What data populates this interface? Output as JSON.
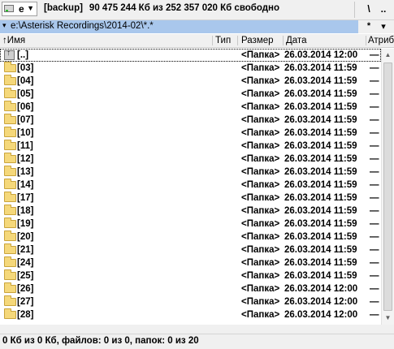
{
  "drive": {
    "letter": "e",
    "label": "[backup]",
    "free_space": "90 475 244 Кб из 252 357 020 Кб свободно",
    "root_button": "\\",
    "parent_button": ".."
  },
  "path": {
    "caret": "▾",
    "text": "e:\\Asterisk Recordings\\2014-02\\*.*",
    "history_button": "*",
    "dropdown_button": "▾"
  },
  "columns": {
    "sort_arrow": "↑",
    "name": "Имя",
    "type": "Тип",
    "size": "Размер",
    "date": "Дата",
    "attr": "Атриб"
  },
  "rows": [
    {
      "name": "[..]",
      "size": "<Папка>",
      "date": "26.03.2014 12:00",
      "attr": "—",
      "icon": "up-dir-icon"
    },
    {
      "name": "[03]",
      "size": "<Папка>",
      "date": "26.03.2014 11:59",
      "attr": "—",
      "icon": "folder-icon"
    },
    {
      "name": "[04]",
      "size": "<Папка>",
      "date": "26.03.2014 11:59",
      "attr": "—",
      "icon": "folder-icon"
    },
    {
      "name": "[05]",
      "size": "<Папка>",
      "date": "26.03.2014 11:59",
      "attr": "—",
      "icon": "folder-icon"
    },
    {
      "name": "[06]",
      "size": "<Папка>",
      "date": "26.03.2014 11:59",
      "attr": "—",
      "icon": "folder-icon"
    },
    {
      "name": "[07]",
      "size": "<Папка>",
      "date": "26.03.2014 11:59",
      "attr": "—",
      "icon": "folder-icon"
    },
    {
      "name": "[10]",
      "size": "<Папка>",
      "date": "26.03.2014 11:59",
      "attr": "—",
      "icon": "folder-icon"
    },
    {
      "name": "[11]",
      "size": "<Папка>",
      "date": "26.03.2014 11:59",
      "attr": "—",
      "icon": "folder-icon"
    },
    {
      "name": "[12]",
      "size": "<Папка>",
      "date": "26.03.2014 11:59",
      "attr": "—",
      "icon": "folder-icon"
    },
    {
      "name": "[13]",
      "size": "<Папка>",
      "date": "26.03.2014 11:59",
      "attr": "—",
      "icon": "folder-icon"
    },
    {
      "name": "[14]",
      "size": "<Папка>",
      "date": "26.03.2014 11:59",
      "attr": "—",
      "icon": "folder-icon"
    },
    {
      "name": "[17]",
      "size": "<Папка>",
      "date": "26.03.2014 11:59",
      "attr": "—",
      "icon": "folder-icon"
    },
    {
      "name": "[18]",
      "size": "<Папка>",
      "date": "26.03.2014 11:59",
      "attr": "—",
      "icon": "folder-icon"
    },
    {
      "name": "[19]",
      "size": "<Папка>",
      "date": "26.03.2014 11:59",
      "attr": "—",
      "icon": "folder-icon"
    },
    {
      "name": "[20]",
      "size": "<Папка>",
      "date": "26.03.2014 11:59",
      "attr": "—",
      "icon": "folder-icon"
    },
    {
      "name": "[21]",
      "size": "<Папка>",
      "date": "26.03.2014 11:59",
      "attr": "—",
      "icon": "folder-icon"
    },
    {
      "name": "[24]",
      "size": "<Папка>",
      "date": "26.03.2014 11:59",
      "attr": "—",
      "icon": "folder-icon"
    },
    {
      "name": "[25]",
      "size": "<Папка>",
      "date": "26.03.2014 11:59",
      "attr": "—",
      "icon": "folder-icon"
    },
    {
      "name": "[26]",
      "size": "<Папка>",
      "date": "26.03.2014 12:00",
      "attr": "—",
      "icon": "folder-icon"
    },
    {
      "name": "[27]",
      "size": "<Папка>",
      "date": "26.03.2014 12:00",
      "attr": "—",
      "icon": "folder-icon"
    },
    {
      "name": "[28]",
      "size": "<Папка>",
      "date": "26.03.2014 12:00",
      "attr": "—",
      "icon": "folder-icon"
    }
  ],
  "status": {
    "text": "0 Кб из 0 Кб, файлов: 0 из 0, папок: 0 из 20"
  },
  "scrollbar": {
    "up_arrow": "▲",
    "down_arrow": "▼"
  },
  "colors": {
    "active_path_bg": "#a9c7ec",
    "folder_fill": "#f5d87a"
  }
}
